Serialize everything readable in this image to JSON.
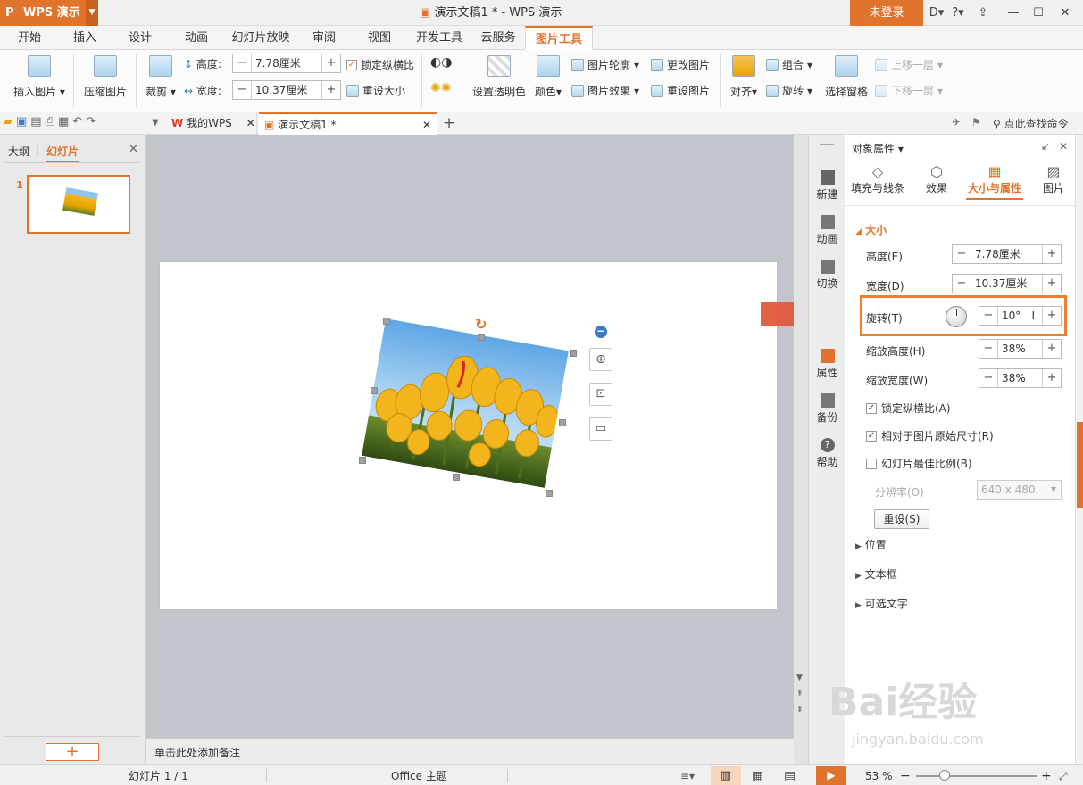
{
  "app": {
    "name": "WPS 演示",
    "window_title": "演示文稿1 * - WPS 演示",
    "login_label": "未登录"
  },
  "menu": [
    "开始",
    "插入",
    "设计",
    "动画",
    "幻灯片放映",
    "审阅",
    "视图",
    "开发工具",
    "云服务",
    "图片工具"
  ],
  "ribbon": {
    "insert_picture": "插入图片",
    "compress_picture": "压缩图片",
    "crop": "裁剪",
    "height_label": "高度:",
    "height_value": "7.78厘米",
    "width_label": "宽度:",
    "width_value": "10.37厘米",
    "lock_ratio": "锁定纵横比",
    "reset_size": "重设大小",
    "set_transparent": "设置透明色",
    "color": "颜色",
    "picture_outline": "图片轮廓",
    "picture_effect": "图片效果",
    "change_picture": "更改图片",
    "reset_picture": "重设图片",
    "align": "对齐",
    "group": "组合",
    "rotate": "旋转",
    "selection_pane": "选择窗格",
    "bring_forward": "上移一层",
    "send_backward": "下移一层"
  },
  "tabs": {
    "my_wps": "我的WPS",
    "doc": "演示文稿1 *",
    "search": "点此查找命令"
  },
  "left_panel": {
    "tab_outline": "大纲",
    "tab_slides": "幻灯片",
    "slide_number": "1"
  },
  "notes_placeholder": "单击此处添加备注",
  "sidebar": [
    "新建",
    "动画",
    "切换",
    "属性",
    "备份",
    "帮助"
  ],
  "panel": {
    "title": "对象属性",
    "tabs": [
      "填充与线条",
      "效果",
      "大小与属性",
      "图片"
    ],
    "section_size": "大小",
    "height_label": "高度(E)",
    "height_value": "7.78厘米",
    "width_label": "宽度(D)",
    "width_value": "10.37厘米",
    "rotate_label": "旋转(T)",
    "rotate_value": "10°",
    "scale_h_label": "缩放高度(H)",
    "scale_h_value": "38%",
    "scale_w_label": "缩放宽度(W)",
    "scale_w_value": "38%",
    "lock_ratio": "锁定纵横比(A)",
    "relative_original": "相对于图片原始尺寸(R)",
    "best_scale": "幻灯片最佳比例(B)",
    "resolution_label": "分辨率(O)",
    "resolution_value": "640 x 480",
    "reset_button": "重设(S)",
    "section_position": "位置",
    "section_textbox": "文本框",
    "section_alt_text": "可选文字"
  },
  "status": {
    "slide_indicator": "幻灯片 1 / 1",
    "theme": "Office 主题",
    "zoom": "53 %"
  },
  "watermark": {
    "brand": "Bai经验",
    "url": "jingyan.baidu.com"
  },
  "colors": {
    "accent": "#e0742d",
    "highlight_box": "#ee7d2d",
    "arrow": "#e05a3a"
  }
}
